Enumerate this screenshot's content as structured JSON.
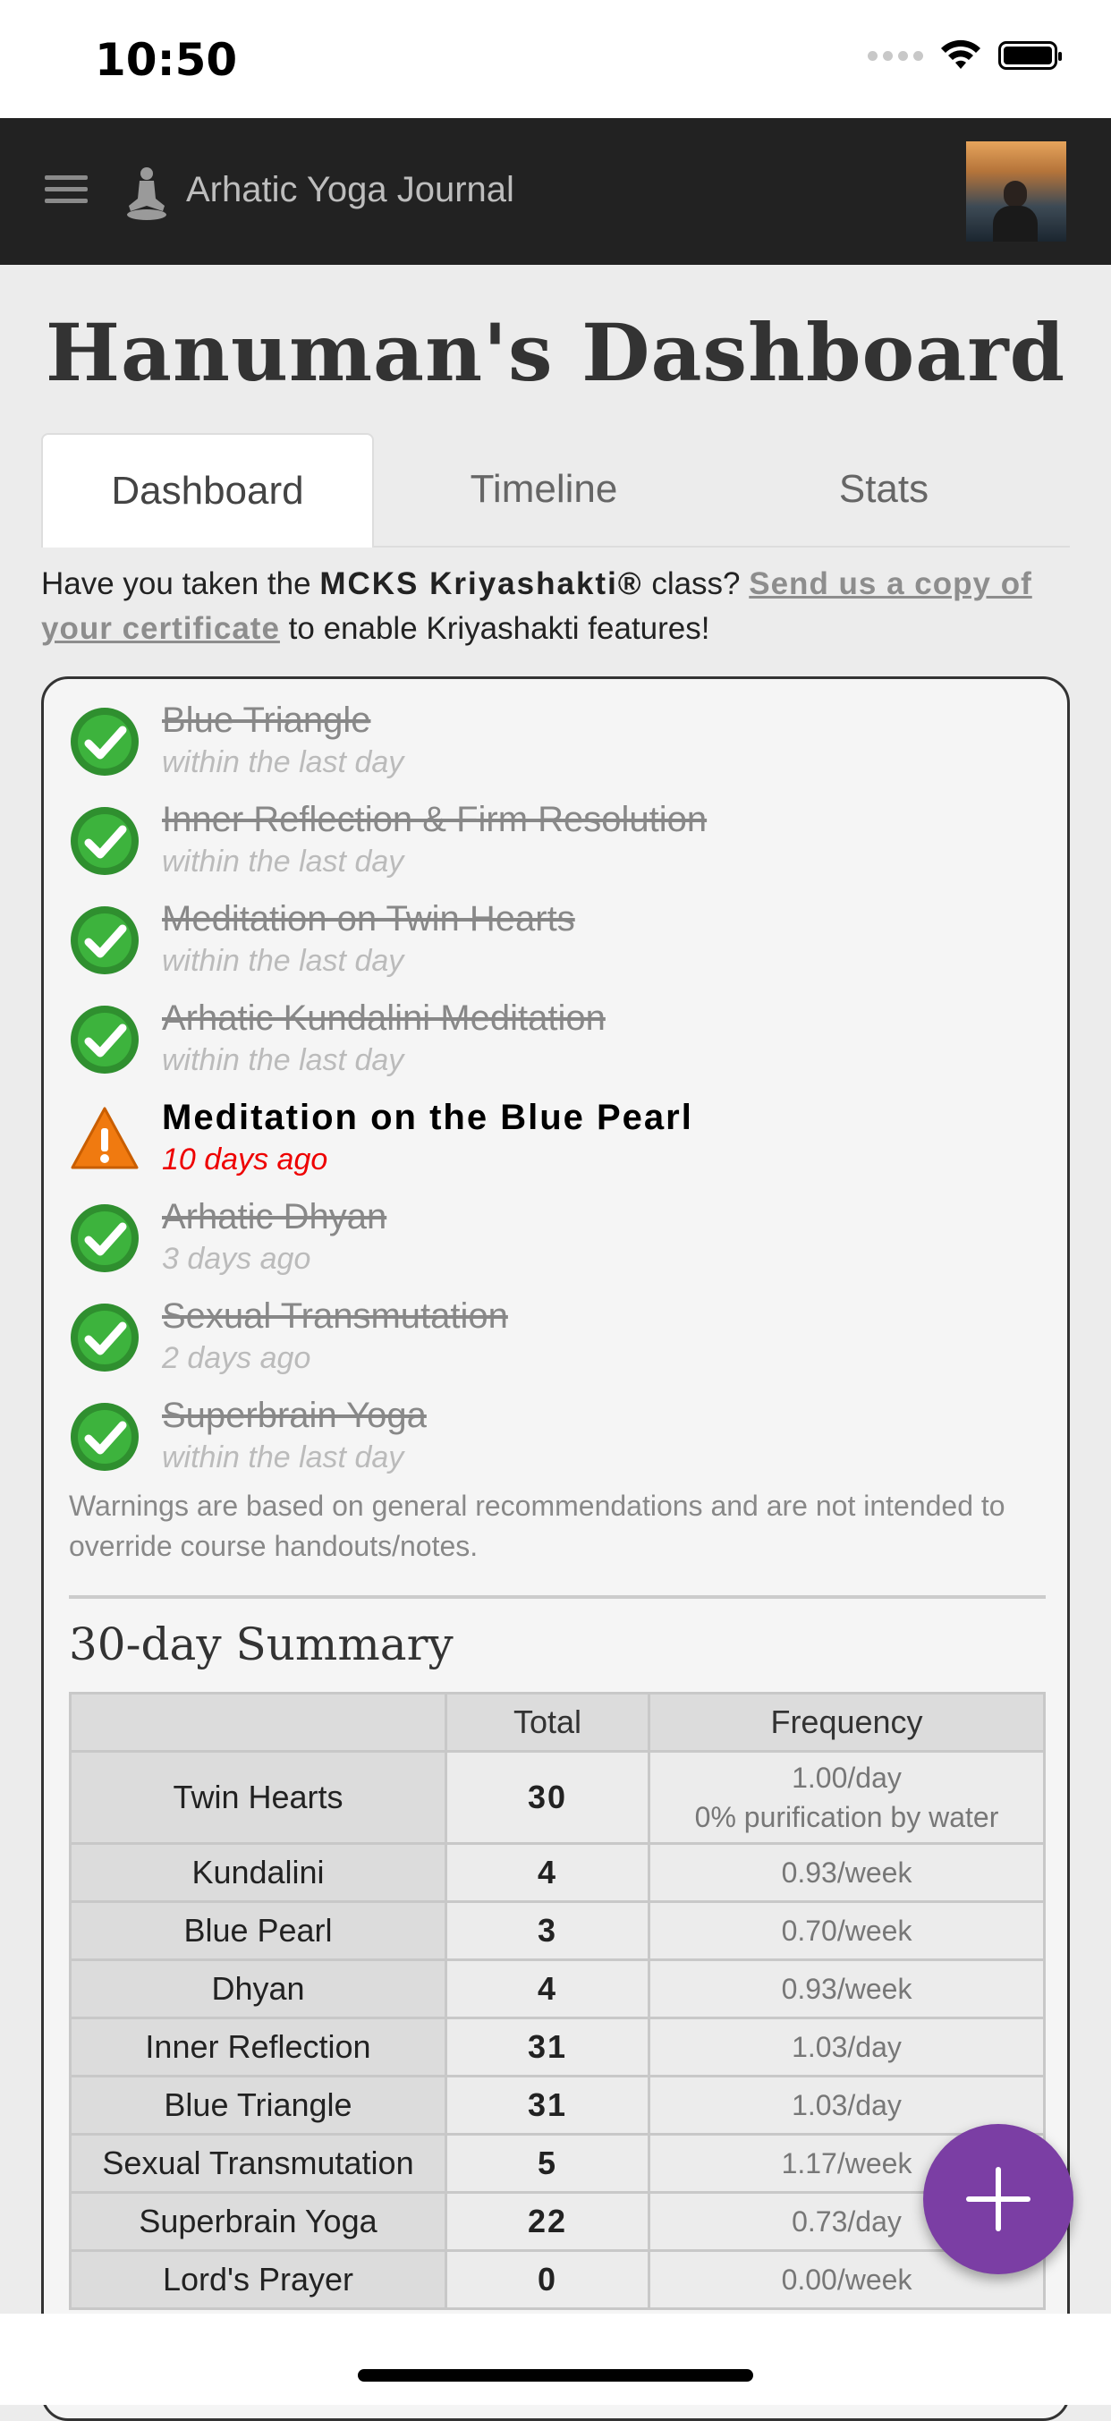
{
  "status_bar": {
    "time": "10:50"
  },
  "navbar": {
    "brand": "Arhatic Yoga Journal"
  },
  "page_title": "Hanuman's Dashboard",
  "tabs": [
    {
      "label": "Dashboard",
      "active": true
    },
    {
      "label": "Timeline",
      "active": false
    },
    {
      "label": "Stats",
      "active": false
    }
  ],
  "notice": {
    "prefix": "Have you taken the ",
    "class_name": "MCKS Kriyashakti®",
    "middle": " class? ",
    "link": "Send us a copy of your certificate",
    "suffix": " to enable Kriyashakti features!"
  },
  "practices": [
    {
      "name": "Blue Triangle",
      "when": "within the last day",
      "status": "done"
    },
    {
      "name": "Inner Reflection & Firm Resolution",
      "when": "within the last day",
      "status": "done"
    },
    {
      "name": "Meditation on Twin Hearts",
      "when": "within the last day",
      "status": "done"
    },
    {
      "name": "Arhatic Kundalini Meditation",
      "when": "within the last day",
      "status": "done"
    },
    {
      "name": "Meditation on the Blue Pearl",
      "when": "10 days ago",
      "status": "warning"
    },
    {
      "name": "Arhatic Dhyan",
      "when": "3 days ago",
      "status": "done"
    },
    {
      "name": "Sexual Transmutation",
      "when": "2 days ago",
      "status": "done"
    },
    {
      "name": "Superbrain Yoga",
      "when": "within the last day",
      "status": "done"
    }
  ],
  "disclaimer": "Warnings are based on general recommendations and are not intended to override course handouts/notes.",
  "summary": {
    "title": "30-day Summary",
    "headers": [
      "",
      "Total",
      "Frequency"
    ],
    "rows": [
      {
        "label": "Twin Hearts",
        "total": "30",
        "freq": "1.00/day",
        "freq2": "0% purification by water"
      },
      {
        "label": "Kundalini",
        "total": "4",
        "freq": "0.93/week"
      },
      {
        "label": "Blue Pearl",
        "total": "3",
        "freq": "0.70/week"
      },
      {
        "label": "Dhyan",
        "total": "4",
        "freq": "0.93/week"
      },
      {
        "label": "Inner Reflection",
        "total": "31",
        "freq": "1.03/day"
      },
      {
        "label": "Blue Triangle",
        "total": "31",
        "freq": "1.03/day"
      },
      {
        "label": "Sexual Transmutation",
        "total": "5",
        "freq": "1.17/week"
      },
      {
        "label": "Superbrain Yoga",
        "total": "22",
        "freq": "0.73/day"
      },
      {
        "label": "Lord's Prayer",
        "total": "0",
        "freq": "0.00/week"
      }
    ]
  },
  "colors": {
    "fab": "#7b3ea4",
    "navbar": "#222222",
    "warning_text": "#ee0000"
  }
}
